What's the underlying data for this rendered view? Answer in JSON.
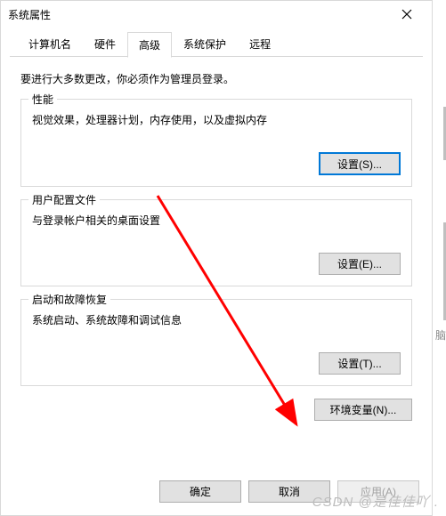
{
  "window": {
    "title": "系统属性"
  },
  "tabs": {
    "items": [
      {
        "label": "计算机名"
      },
      {
        "label": "硬件"
      },
      {
        "label": "高级"
      },
      {
        "label": "系统保护"
      },
      {
        "label": "远程"
      }
    ],
    "active_index": 2
  },
  "intro": "要进行大多数更改，你必须作为管理员登录。",
  "groups": {
    "perf": {
      "title": "性能",
      "desc": "视觉效果，处理器计划，内存使用，以及虚拟内存",
      "button": "设置(S)..."
    },
    "user": {
      "title": "用户配置文件",
      "desc": "与登录帐户相关的桌面设置",
      "button": "设置(E)..."
    },
    "boot": {
      "title": "启动和故障恢复",
      "desc": "系统启动、系统故障和调试信息",
      "button": "设置(T)..."
    }
  },
  "envvar_button": "环境变量(N)...",
  "buttons": {
    "ok": "确定",
    "cancel": "取消",
    "apply": "应用(A)"
  },
  "watermark": "CSDN @是佳佳吖 .",
  "side_text": "脑"
}
